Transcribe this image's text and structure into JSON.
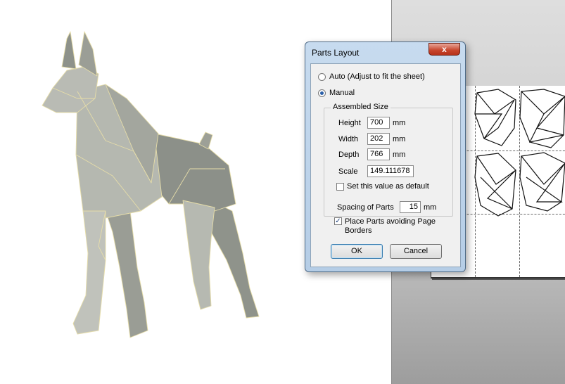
{
  "dialog": {
    "title": "Parts Layout",
    "close_glyph": "x",
    "mode_options": [
      {
        "label": "Auto (Adjust to fit the sheet)",
        "selected": false
      },
      {
        "label": "Manual",
        "selected": true
      }
    ],
    "assembled_size": {
      "group_label": "Assembled Size",
      "height": {
        "label": "Height",
        "value": "700",
        "unit": "mm"
      },
      "width": {
        "label": "Width",
        "value": "202",
        "unit": "mm"
      },
      "depth": {
        "label": "Depth",
        "value": "766",
        "unit": "mm"
      },
      "scale": {
        "label": "Scale",
        "value": "149.111678"
      },
      "default_checkbox": {
        "label": "Set this value as default",
        "checked": false
      }
    },
    "spacing": {
      "label": "Spacing of Parts",
      "value": "15",
      "unit": "mm"
    },
    "avoid_borders": {
      "label_line1": "Place Parts avoiding Page",
      "label_line2": "Borders",
      "checked": true
    },
    "ok_label": "OK",
    "cancel_label": "Cancel"
  },
  "icons": {
    "model": "dog-3d-model-icon",
    "sheet": "unfolded-parts-sheet-icon"
  },
  "colors": {
    "model_fill": "#a7aaa2",
    "model_edge": "#e6dda9",
    "title_bar": "#b5cde6",
    "close_button": "#c7442b",
    "default_button_border": "#3c7fb1"
  }
}
